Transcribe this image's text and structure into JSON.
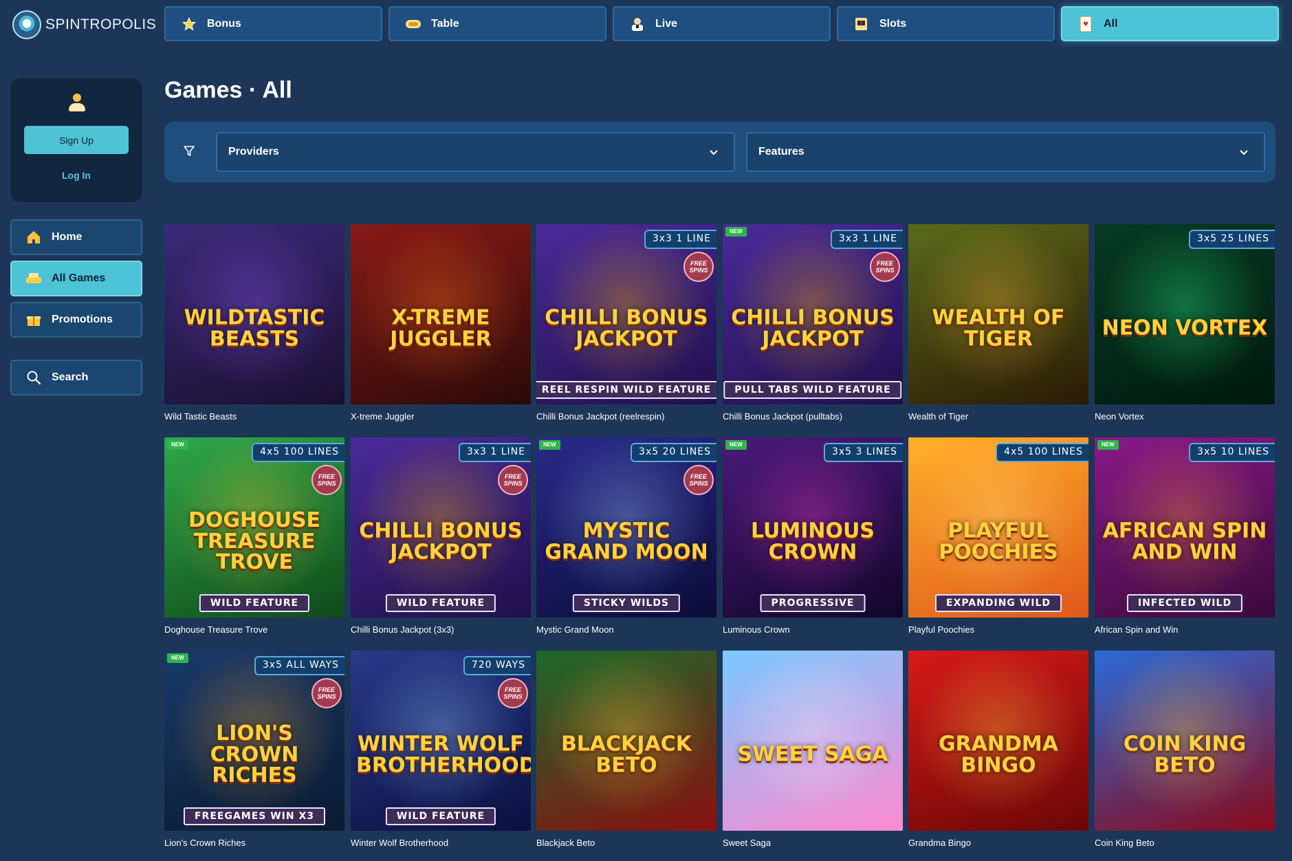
{
  "brand": {
    "name_light": "SPIN",
    "name_bold": "TROPOLIS"
  },
  "topnav": [
    {
      "label": "Bonus",
      "icon": "star-icon",
      "active": false
    },
    {
      "label": "Table",
      "icon": "chip-icon",
      "active": false
    },
    {
      "label": "Live",
      "icon": "dealer-icon",
      "active": false
    },
    {
      "label": "Slots",
      "icon": "slot-machine-icon",
      "active": false
    },
    {
      "label": "All",
      "icon": "card-icon",
      "active": true
    }
  ],
  "account": {
    "signup_label": "Sign Up",
    "login_label": "Log In"
  },
  "sidebar": [
    {
      "label": "Home",
      "icon": "home-icon",
      "active": false
    },
    {
      "label": "All Games",
      "icon": "games-icon",
      "active": true
    },
    {
      "label": "Promotions",
      "icon": "gift-icon",
      "active": false
    },
    {
      "label": "Search",
      "icon": "search-icon",
      "active": false
    }
  ],
  "page_title": "Games · All",
  "filters": {
    "providers_label": "Providers",
    "features_label": "Features"
  },
  "games": [
    {
      "name": "Wild Tastic Beasts",
      "art_title": "WILDTASTIC BEASTS",
      "badge": "",
      "new": false,
      "free_spins": false,
      "feature": "",
      "bg1": "#3a2a78",
      "bg2": "#1a1030",
      "glow": "#8f58ff"
    },
    {
      "name": "X-treme Juggler",
      "art_title": "X-TREME JUGGLER",
      "badge": "",
      "new": false,
      "free_spins": false,
      "feature": "",
      "bg1": "#8a1a18",
      "bg2": "#2a0a08",
      "glow": "#ff7a1a"
    },
    {
      "name": "Chilli Bonus Jackpot (reelrespin)",
      "art_title": "CHILLI BONUS JACKPOT",
      "badge": "3x3  1 LINE",
      "new": false,
      "free_spins": true,
      "feature": "REEL RESPIN  WILD FEATURE",
      "bg1": "#4a2a9a",
      "bg2": "#20104a",
      "glow": "#ffb800"
    },
    {
      "name": "Chilli Bonus Jackpot (pulltabs)",
      "art_title": "CHILLI BONUS JACKPOT",
      "badge": "3x3  1 LINE",
      "new": true,
      "free_spins": true,
      "feature": "PULL TABS  WILD FEATURE",
      "bg1": "#4a2a9a",
      "bg2": "#20104a",
      "glow": "#ffb800"
    },
    {
      "name": "Wealth of Tiger",
      "art_title": "WEALTH OF TIGER",
      "badge": "",
      "new": false,
      "free_spins": false,
      "feature": "",
      "bg1": "#5a6a1a",
      "bg2": "#2a1a06",
      "glow": "#ffb23a"
    },
    {
      "name": "Neon Vortex",
      "art_title": "NEON VORTEX",
      "badge": "3x5  25 LINES",
      "new": false,
      "free_spins": false,
      "feature": "",
      "bg1": "#073a24",
      "bg2": "#021a10",
      "glow": "#26ff8a"
    },
    {
      "name": "Doghouse Treasure Trove",
      "art_title": "DOGHOUSE TREASURE TROVE",
      "badge": "4x5  100 LINES",
      "new": true,
      "free_spins": true,
      "feature": "WILD FEATURE",
      "bg1": "#2fa84a",
      "bg2": "#0f4a1a",
      "glow": "#ffcc33"
    },
    {
      "name": "Chilli Bonus Jackpot (3x3)",
      "art_title": "CHILLI BONUS JACKPOT",
      "badge": "3x3  1 LINE",
      "new": false,
      "free_spins": true,
      "feature": "WILD FEATURE",
      "bg1": "#4a2a9a",
      "bg2": "#20104a",
      "glow": "#ffb800"
    },
    {
      "name": "Mystic Grand Moon",
      "art_title": "MYSTIC GRAND MOON",
      "badge": "3x5  20 LINES",
      "new": true,
      "free_spins": true,
      "feature": "STICKY WILDS",
      "bg1": "#2a2a8a",
      "bg2": "#0c0c3a",
      "glow": "#9ec8ff"
    },
    {
      "name": "Luminous Crown",
      "art_title": "LUMINOUS CROWN",
      "badge": "3x5  3 LINES",
      "new": true,
      "free_spins": false,
      "feature": "PROGRESSIVE",
      "bg1": "#4a1a7a",
      "bg2": "#12062a",
      "glow": "#ff38d0"
    },
    {
      "name": "Playful Poochies",
      "art_title": "PLAYFUL POOCHIES",
      "badge": "4x5  100 LINES",
      "new": false,
      "free_spins": false,
      "feature": "EXPANDING WILD",
      "bg1": "#ffb02a",
      "bg2": "#e0581a",
      "glow": "#ffe080"
    },
    {
      "name": "African Spin and Win",
      "art_title": "AFRICAN SPIN AND WIN",
      "badge": "3x5  10 LINES",
      "new": true,
      "free_spins": false,
      "feature": "INFECTED WILD",
      "bg1": "#8a1a8a",
      "bg2": "#3a0a3a",
      "glow": "#ff9a2a"
    },
    {
      "name": "Lion's Crown Riches",
      "art_title": "LION'S CROWN RICHES",
      "badge": "3x5  ALL WAYS",
      "new": true,
      "free_spins": true,
      "feature": "FREEGAMES WIN X3",
      "bg1": "#1a3a6a",
      "bg2": "#0a1a30",
      "glow": "#ffa82a"
    },
    {
      "name": "Winter Wolf Brotherhood",
      "art_title": "WINTER WOLF BROTHERHOOD",
      "badge": "720 WAYS",
      "new": false,
      "free_spins": true,
      "feature": "WILD FEATURE",
      "bg1": "#2a3a8a",
      "bg2": "#0a1040",
      "glow": "#9ac8ff"
    },
    {
      "name": "Blackjack Beto",
      "art_title": "BLACKJACK BETO",
      "badge": "",
      "new": false,
      "free_spins": false,
      "feature": "",
      "bg1": "#1a6a2a",
      "bg2": "#8a1010",
      "glow": "#ffd23e"
    },
    {
      "name": "Sweet Saga",
      "art_title": "SWEET SAGA",
      "badge": "",
      "new": false,
      "free_spins": false,
      "feature": "",
      "bg1": "#7ac8ff",
      "bg2": "#ff8ad0",
      "glow": "#ffe4f4"
    },
    {
      "name": "Grandma Bingo",
      "art_title": "GRANDMA BINGO",
      "badge": "",
      "new": false,
      "free_spins": false,
      "feature": "",
      "bg1": "#d81a1a",
      "bg2": "#6a0606",
      "glow": "#ffd23e"
    },
    {
      "name": "Coin King Beto",
      "art_title": "COIN KING BETO",
      "badge": "",
      "new": false,
      "free_spins": false,
      "feature": "",
      "bg1": "#2a6ad8",
      "bg2": "#8a0a1a",
      "glow": "#ffd23e"
    }
  ]
}
